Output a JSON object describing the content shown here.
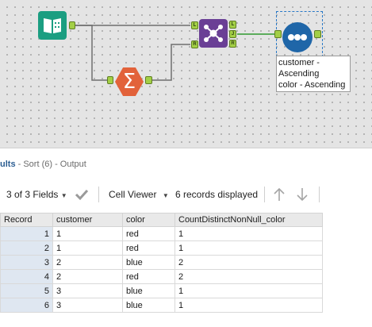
{
  "canvas": {
    "tools": {
      "browse": {
        "icon": "browse-icon",
        "color": "#1b9e81"
      },
      "summarize": {
        "icon": "sigma-icon",
        "glyph": "Σ",
        "color": "#e2623a"
      },
      "join": {
        "icon": "join-icon",
        "color": "#6a3f95",
        "anchors": [
          "L",
          "R",
          "L",
          "J",
          "R"
        ]
      },
      "sort": {
        "icon": "sort-icon",
        "color": "#1f66a8"
      }
    },
    "sort_annotation": [
      "customer -",
      "Ascending",
      "color - Ascending"
    ]
  },
  "results": {
    "title_prefix": "ults",
    "title_suffix": " - Sort (6) - Output",
    "fields_dropdown": "3 of 3 Fields",
    "viewer_dropdown": "Cell Viewer",
    "records_count": "6 records displayed",
    "columns": [
      "Record",
      "customer",
      "color",
      "CountDistinctNonNull_color"
    ],
    "rows": [
      [
        "1",
        "1",
        "red",
        "1"
      ],
      [
        "2",
        "1",
        "red",
        "1"
      ],
      [
        "3",
        "2",
        "blue",
        "2"
      ],
      [
        "4",
        "2",
        "red",
        "2"
      ],
      [
        "5",
        "3",
        "blue",
        "1"
      ],
      [
        "6",
        "3",
        "blue",
        "1"
      ]
    ]
  },
  "colors": {
    "accent": "#2c5e92",
    "wire": "#6e6e6e",
    "active_wire": "#2e9a2e",
    "anchor": "#a3cf46"
  }
}
